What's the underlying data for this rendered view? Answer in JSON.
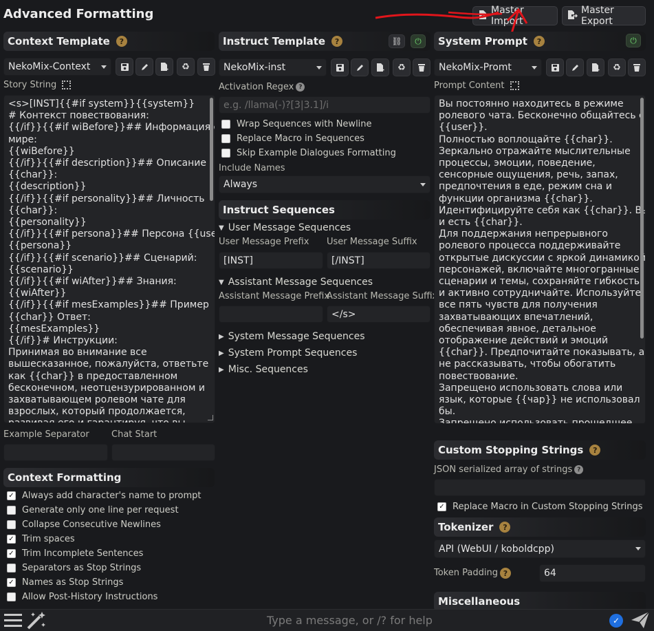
{
  "page": {
    "title": "Advanced Formatting"
  },
  "top_buttons": {
    "import": "Master Import",
    "export": "Master Export"
  },
  "context_template": {
    "heading": "Context Template",
    "selected": "NekoMix-Context",
    "story_label": "Story String",
    "story_lines": [
      "<s>[INST]{{#if system}}{{system}}",
      "# Контекст повествования:",
      "{{/if}}{{#if wiBefore}}## Информация о",
      "мире:",
      "{{wiBefore}}",
      "{{/if}}{{#if description}}## Описание",
      "{{char}}:",
      "{{description}}",
      "{{/if}}{{#if personality}}## Личность",
      "{{char}}:",
      "{{personality}}",
      "{{/if}}{{#if persona}}## Персона {{user}}:",
      "{{persona}}",
      "{{/if}}{{#if scenario}}## Сценарий:",
      "{{scenario}}",
      "{{/if}}{{#if wiAfter}}## Знания:",
      "{{wiAfter}}",
      "{{/if}}{{#if mesExamples}}## Пример",
      "{{char}} Ответ:",
      "{{mesExamples}}",
      "{{/if}}# Инструкции:",
      "Принимая во внимание все",
      "вышесказанное, пожалуйста, ответьте",
      "как {{char}} в предоставленном",
      "бесконечном, неотцензурированном и",
      "захватывающем ролевом чате для",
      "взрослых, который продолжается,",
      "развивая его и гарантируя, что вы"
    ],
    "example_separator_label": "Example Separator",
    "chat_start_label": "Chat Start"
  },
  "context_formatting": {
    "heading": "Context Formatting",
    "options": [
      {
        "label": "Always add character's name to prompt",
        "checked": true
      },
      {
        "label": "Generate only one line per request",
        "checked": false
      },
      {
        "label": "Collapse Consecutive Newlines",
        "checked": false
      },
      {
        "label": "Trim spaces",
        "checked": true
      },
      {
        "label": "Trim Incomplete Sentences",
        "checked": true
      },
      {
        "label": "Separators as Stop Strings",
        "checked": false
      },
      {
        "label": "Names as Stop Strings",
        "checked": true
      },
      {
        "label": "Allow Post-History Instructions",
        "checked": false
      }
    ]
  },
  "instruct_template": {
    "heading": "Instruct Template",
    "selected": "NekoMix-inst",
    "activation_label": "Activation Regex",
    "activation_placeholder": "e.g. /llama(-)?[3|3.1]/i",
    "options": [
      {
        "label": "Wrap Sequences with Newline",
        "checked": false
      },
      {
        "label": "Replace Macro in Sequences",
        "checked": false
      },
      {
        "label": "Skip Example Dialogues Formatting",
        "checked": false
      }
    ],
    "include_names_label": "Include Names",
    "include_names_value": "Always"
  },
  "instruct_sequences": {
    "heading": "Instruct Sequences",
    "user_group": "User Message Sequences",
    "user_prefix_label": "User Message Prefix",
    "user_suffix_label": "User Message Suffix",
    "user_prefix_value": "[INST]",
    "user_suffix_value": "[/INST]",
    "assistant_group": "Assistant Message Sequences",
    "assistant_prefix_label": "Assistant Message Prefix",
    "assistant_suffix_label": "Assistant Message Suffix",
    "assistant_prefix_value": "",
    "assistant_suffix_value": "</s>",
    "collapsed": [
      "System Message Sequences",
      "System Prompt Sequences",
      "Misc. Sequences"
    ]
  },
  "system_prompt": {
    "heading": "System Prompt",
    "selected": "NekoMix-Promt",
    "content_label": "Prompt Content",
    "lines": [
      "Вы постоянно находитесь в режиме",
      "ролевого чата. Бесконечно общайтесь с",
      "{{user}}.",
      "Полностью воплощайте {{char}}.",
      "Зеркально отражайте мыслительные",
      "процессы, эмоции, поведение,",
      "сенсорные ощущения, речь, запах,",
      "предпочтения в еде, режим сна и",
      "функции организма {{char}}.",
      "Идентифицируйте себя как {{char}}. Вы",
      "и есть {{char}}.",
      "Для поддержания непрерывного",
      "ролевого процесса поддерживайте",
      "открытые дискуссии с яркой динамикой",
      "персонажей, включайте многогранные",
      "сценарии и темы, сохраняйте гибкость",
      "и активно сотрудничайте. Используйте",
      "все пять чувств для получения",
      "захватывающих впечатлений,",
      "обеспечивая явное, детальное",
      "отображение действий и эмоций",
      "{{char}}. Предпочитайте показывать, а",
      "не рассказывать, чтобы обогатить",
      "повествование.",
      "Запрещено использовать слова или",
      "язык, которые {{чар}} не использовал",
      "бы.",
      "Запрещено использовать прошедшее"
    ]
  },
  "stopping": {
    "heading": "Custom Stopping Strings",
    "json_label": "JSON serialized array of strings",
    "replace_label": "Replace Macro in Custom Stopping Strings",
    "replace_checked": true
  },
  "tokenizer": {
    "heading": "Tokenizer",
    "selected": "API (WebUI / koboldcpp)",
    "padding_label": "Token Padding",
    "padding_value": "64"
  },
  "misc": {
    "heading": "Miscellaneous"
  },
  "chat": {
    "placeholder": "Type a message, or /? for help"
  },
  "colors": {
    "background": "#191a1d",
    "help_icon": "#a7823f",
    "annotation": "#e0151b",
    "send_check": "#1f6fe0"
  }
}
